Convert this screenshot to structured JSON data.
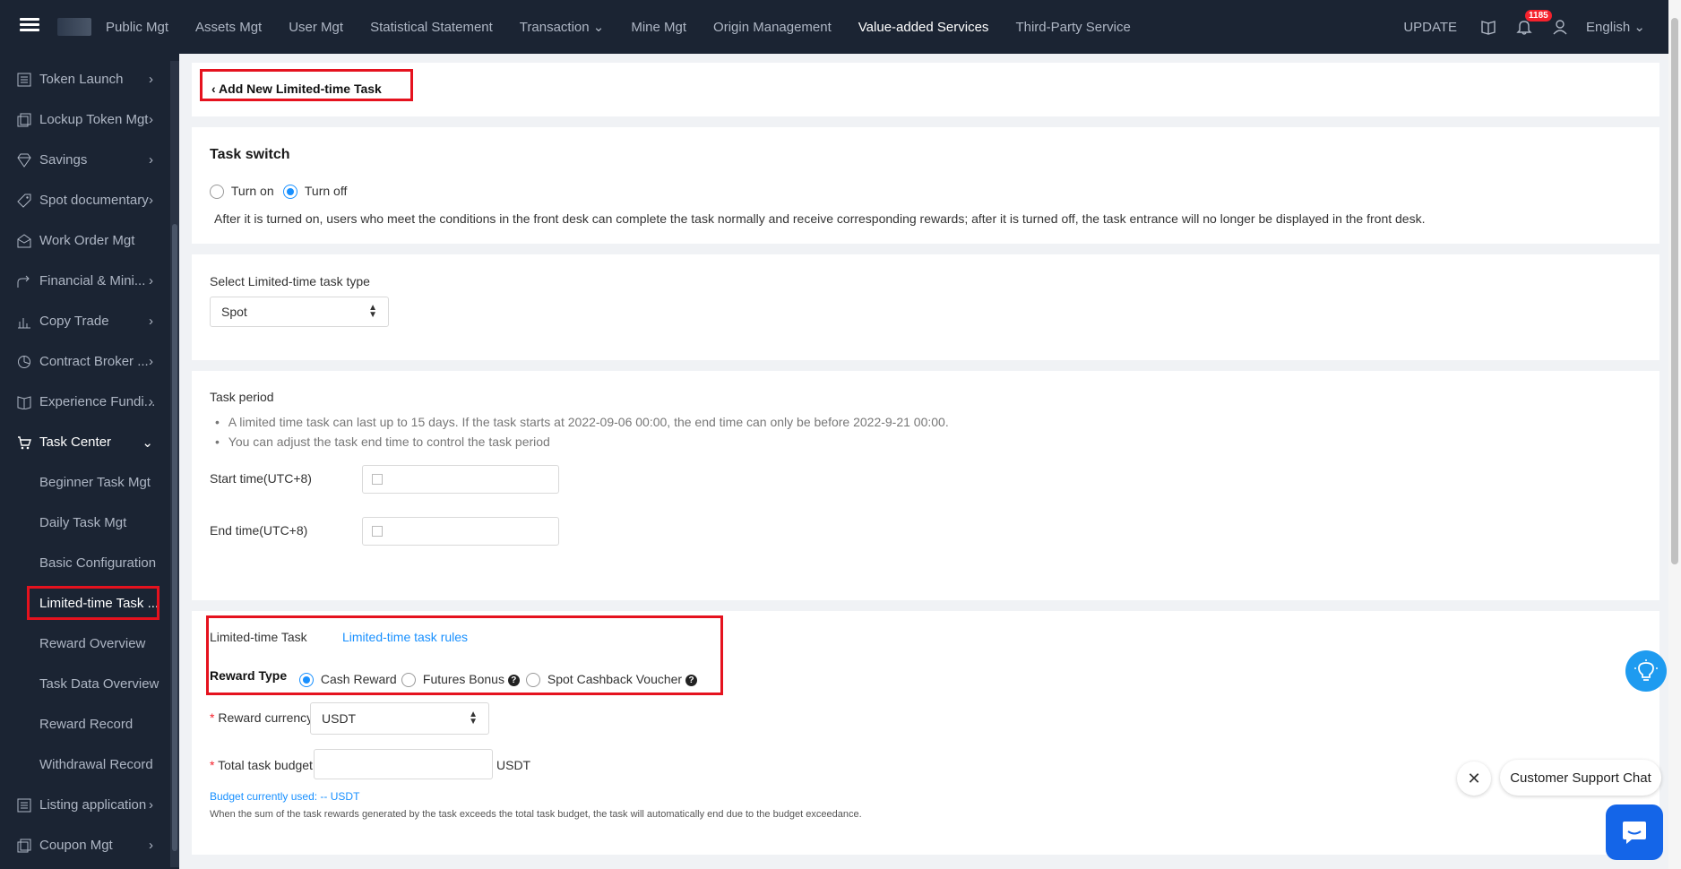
{
  "topnav": {
    "items": [
      "Public Mgt",
      "Assets Mgt",
      "User Mgt",
      "Statistical Statement",
      "Transaction",
      "Mine Mgt",
      "Origin Management",
      "Value-added Services",
      "Third-Party Service"
    ],
    "update_label": "UPDATE",
    "notification_count": "1185",
    "language": "English"
  },
  "sidebar": {
    "items": [
      "Token Launch",
      "Lockup Token Mgt",
      "Savings",
      "Spot documentary",
      "Work Order Mgt",
      "Financial & Mini...",
      "Copy Trade",
      "Contract Broker ...",
      "Experience Fundi...",
      "Task Center"
    ],
    "sub_items": [
      "Beginner Task Mgt",
      "Daily Task Mgt",
      "Basic Configuration",
      "Limited-time Task ...",
      "Reward Overview",
      "Task Data Overview",
      "Reward Record",
      "Withdrawal Record"
    ],
    "bottom_items": [
      "Listing application",
      "Coupon Mgt"
    ]
  },
  "header": {
    "back_title": "Add New Limited-time Task"
  },
  "task_switch": {
    "title": "Task switch",
    "on_label": "Turn on",
    "off_label": "Turn off",
    "selected": "off",
    "description": "After it is turned on, users who meet the conditions in the front desk can complete the task normally and receive corresponding rewards; after it is turned off, the task entrance will no longer be displayed in the front desk."
  },
  "task_type": {
    "label": "Select Limited-time task type",
    "value": "Spot"
  },
  "task_period": {
    "title": "Task period",
    "note1": "A limited time task can last up to 15 days. If the task starts at 2022-09-06 00:00, the end time can only be before 2022-9-21 00:00.",
    "note2": "You can adjust the task end time to control the task period",
    "start_label": "Start time(UTC+8)",
    "end_label": "End time(UTC+8)"
  },
  "reward": {
    "task_label": "Limited-time Task",
    "rules_link": "Limited-time task rules",
    "type_label": "Reward Type",
    "options": [
      "Cash Reward",
      "Futures Bonus",
      "Spot Cashback Voucher"
    ],
    "selected": "Cash Reward",
    "currency_label": "Reward currency",
    "currency_value": "USDT",
    "budget_label": "Total task budget",
    "budget_unit": "USDT",
    "budget_used": "Budget currently used:  -- USDT",
    "budget_note": "When the sum of the task rewards generated by the task exceeds the total task budget, the task will automatically end due to the budget exceedance."
  },
  "chat": {
    "label": "Customer Support Chat"
  },
  "colors": {
    "nav_bg": "#1b2433",
    "accent": "#1890ff",
    "highlight": "#e5121e"
  }
}
